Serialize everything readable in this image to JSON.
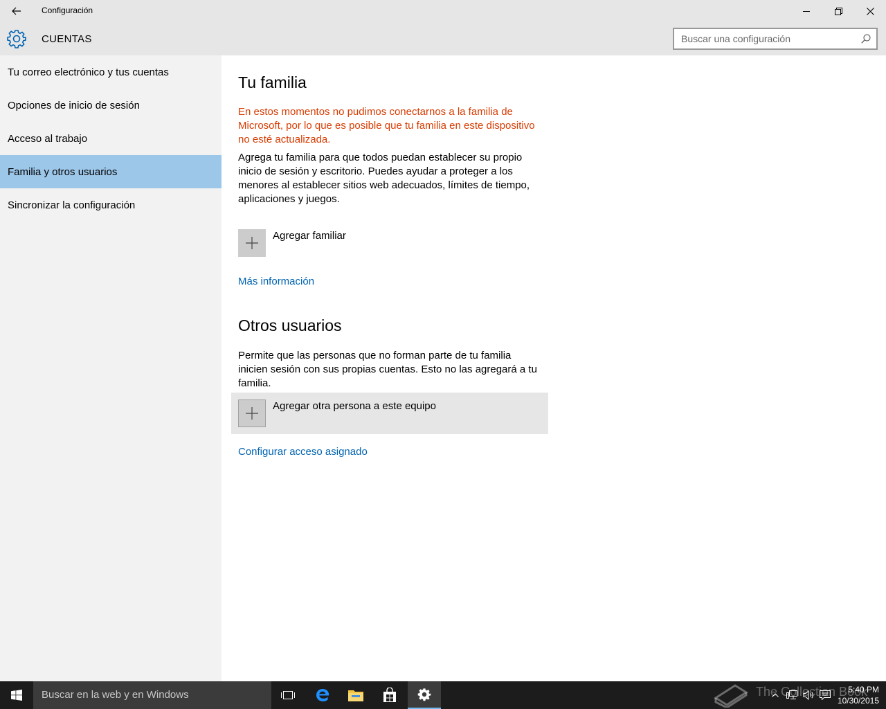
{
  "window": {
    "title": "Configuración"
  },
  "header": {
    "title": "CUENTAS",
    "search_placeholder": "Buscar una configuración"
  },
  "sidebar": {
    "items": [
      {
        "label": "Tu correo electrónico y tus cuentas",
        "selected": false
      },
      {
        "label": "Opciones de inicio de sesión",
        "selected": false
      },
      {
        "label": "Acceso al trabajo",
        "selected": false
      },
      {
        "label": "Familia y otros usuarios",
        "selected": true
      },
      {
        "label": "Sincronizar la configuración",
        "selected": false
      }
    ]
  },
  "main": {
    "family": {
      "heading": "Tu familia",
      "error_text": "En estos momentos no pudimos conectarnos a la familia de Microsoft, por lo que es posible que tu familia en este dispositivo no esté actualizada.",
      "description": "Agrega tu familia para que todos puedan establecer su propio inicio de sesión y escritorio. Puedes ayudar a proteger a los menores al establecer sitios web adecuados, límites de tiempo, aplicaciones y juegos.",
      "add_label": "Agregar familiar",
      "more_info_link": "Más información"
    },
    "others": {
      "heading": "Otros usuarios",
      "description": "Permite que las personas que no forman parte de tu familia inicien sesión con sus propias cuentas. Esto no las agregará a tu familia.",
      "add_label": "Agregar otra persona a este equipo",
      "assigned_access_link": "Configurar acceso asignado"
    }
  },
  "taskbar": {
    "search_text": "Buscar en la web y en Windows",
    "apps": [
      "task-view-icon",
      "edge-icon",
      "file-explorer-icon",
      "store-icon",
      "settings-icon"
    ],
    "active_app": "settings-icon",
    "watermark": "The Collection Book",
    "time": "5:40 PM",
    "date": "10/30/2015"
  },
  "colors": {
    "accent": "#0063b1",
    "error": "#d83b01",
    "selected_nav": "#9dc7e9",
    "chrome": "#e6e6e6",
    "sidebar": "#f2f2f2"
  }
}
